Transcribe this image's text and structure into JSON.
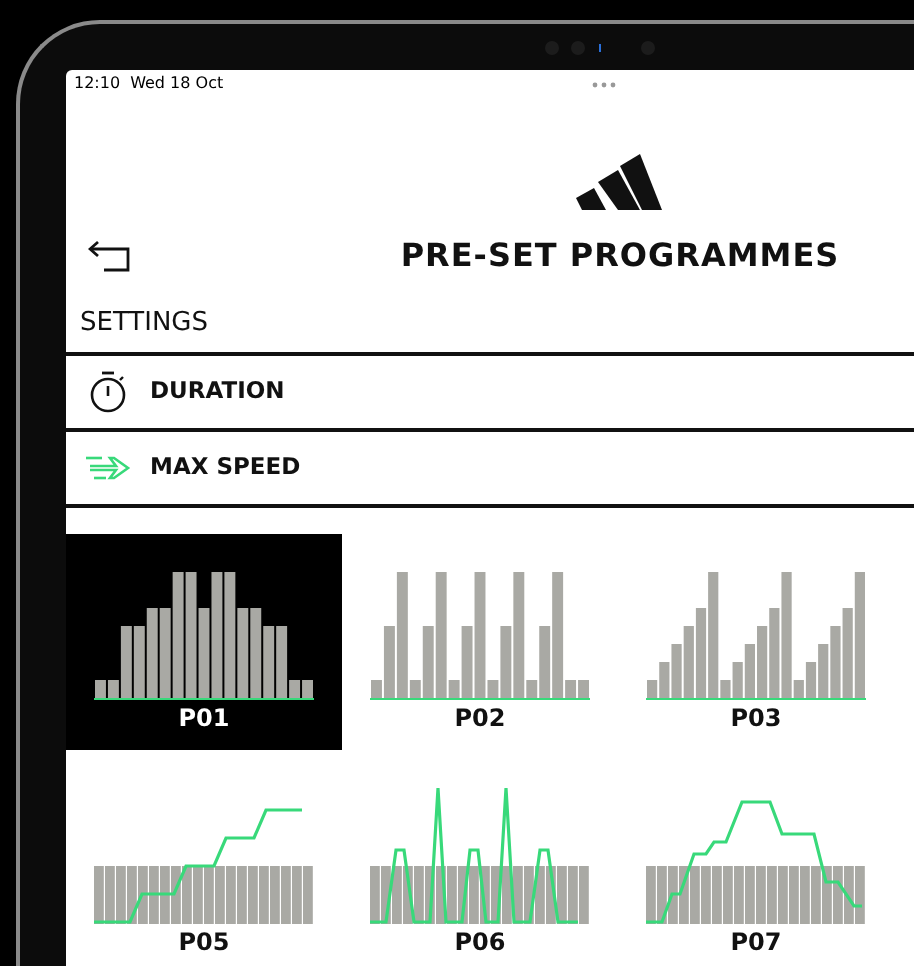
{
  "status_bar": {
    "time": "12:10",
    "date": "Wed 18 Oct"
  },
  "header": {
    "title": "PRE-SET PROGRAMMES"
  },
  "settings": {
    "heading": "SETTINGS",
    "items": [
      {
        "kind": "duration",
        "label": "DURATION"
      },
      {
        "kind": "speed",
        "label": "MAX SPEED"
      }
    ]
  },
  "programmes": [
    {
      "label": "P01",
      "kind": "bars",
      "selected": true
    },
    {
      "label": "P02",
      "kind": "bars",
      "selected": false
    },
    {
      "label": "P03",
      "kind": "bars",
      "selected": false
    },
    {
      "label": "P05",
      "kind": "line",
      "selected": false
    },
    {
      "label": "P06",
      "kind": "line",
      "selected": false
    },
    {
      "label": "P07",
      "kind": "line",
      "selected": false
    }
  ]
}
